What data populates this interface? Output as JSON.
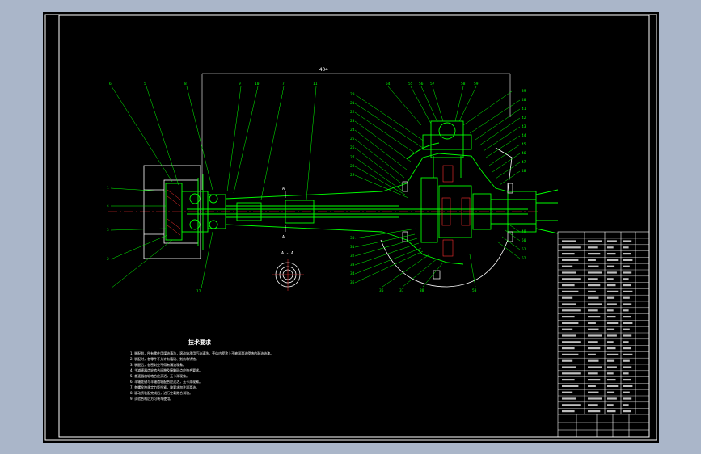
{
  "colors": {
    "background": "#aab6c9",
    "sheet": "#000000",
    "frame": "#ffffff",
    "part_lines": "#00ff00",
    "leader_lines": "#00ff00",
    "centerline": "#ff3030"
  },
  "drawing": {
    "overall_dim_label": "404",
    "section_label": "A - A",
    "section_marks": [
      "A",
      "A"
    ],
    "left_callouts": [
      "6",
      "5",
      "8",
      "9",
      "10",
      "7",
      "11",
      "1",
      "4",
      "3",
      "2",
      "12"
    ],
    "right_callouts": [
      "20",
      "21",
      "22",
      "23",
      "24",
      "25",
      "26",
      "27",
      "28",
      "29",
      "30",
      "31",
      "32",
      "33",
      "34",
      "35",
      "36",
      "37",
      "38",
      "39",
      "40",
      "41",
      "42",
      "43",
      "44",
      "45",
      "46",
      "47",
      "48",
      "49",
      "50",
      "51",
      "52",
      "53",
      "54",
      "55",
      "56",
      "57",
      "58",
      "59",
      "60",
      "61",
      "62"
    ]
  },
  "notes": {
    "title": "技术要求",
    "lines": [
      "1. 装配前，所有零件用煤油清洗，滚动轴承用汽油清洗，壳体内壁涂上不被润滑油侵蚀的耐油油漆。",
      "2. 装配时，各零件不允许有磕碰、划伤和锈蚀。",
      "3. 装配后，各密封处不得有漏油现象。",
      "4. 主减速器齿轮啮合间隙及接触斑点应符合要求。",
      "5. 差速器齿轮啮合应灵活，无卡滞现象。",
      "6. 半轴花键与半轴齿轮配合应灵活，无卡滞现象。",
      "7. 各螺栓按规定力矩拧紧，按要求加注润滑油。",
      "8. 驱动桥装配完成后，进行空载跑合试验。",
      "9. 试验合格后方可装车使用。"
    ]
  }
}
